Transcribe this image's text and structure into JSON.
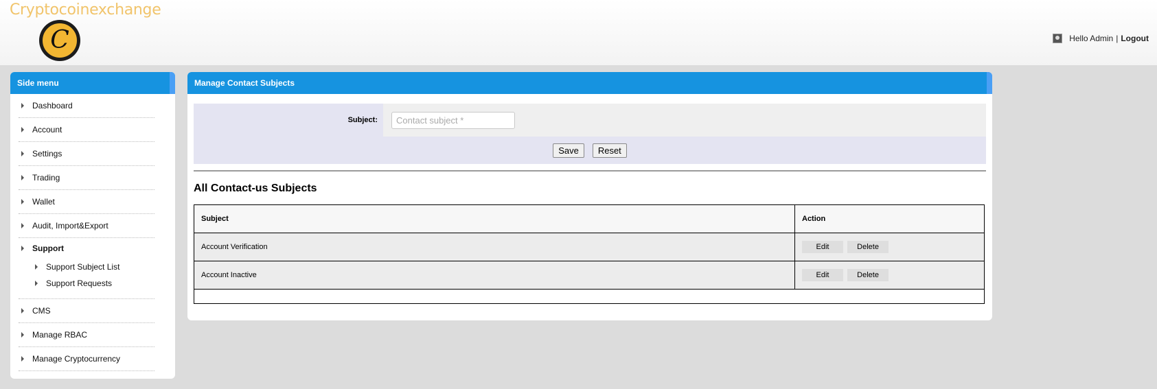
{
  "header": {
    "brand": "Cryptocoinexchange",
    "logo_letter": "C",
    "greeting": "Hello Admin",
    "separator": "|",
    "logout": "Logout"
  },
  "sidebar": {
    "title": "Side menu",
    "items": [
      {
        "label": "Dashboard"
      },
      {
        "label": "Account"
      },
      {
        "label": "Settings"
      },
      {
        "label": "Trading"
      },
      {
        "label": "Wallet"
      },
      {
        "label": "Audit, Import&Export"
      },
      {
        "label": "Support",
        "active": true,
        "children": [
          "Support Subject List",
          "Support Requests"
        ]
      },
      {
        "label": "CMS"
      },
      {
        "label": "Manage RBAC"
      },
      {
        "label": "Manage Cryptocurrency"
      }
    ]
  },
  "main": {
    "title": "Manage Contact Subjects",
    "form": {
      "subject_label": "Subject:",
      "subject_placeholder": "Contact subject *",
      "subject_value": "",
      "save": "Save",
      "reset": "Reset"
    },
    "list_title": "All Contact-us Subjects",
    "table": {
      "headers": [
        "Subject",
        "Action"
      ],
      "rows": [
        {
          "subject": "Account Verification",
          "edit": "Edit",
          "delete": "Delete"
        },
        {
          "subject": "Account Inactive",
          "edit": "Edit",
          "delete": "Delete"
        }
      ]
    }
  },
  "colors": {
    "panel_header": "#1693e0",
    "brand": "#f1c46b",
    "page_bg": "#dcdcdc"
  }
}
